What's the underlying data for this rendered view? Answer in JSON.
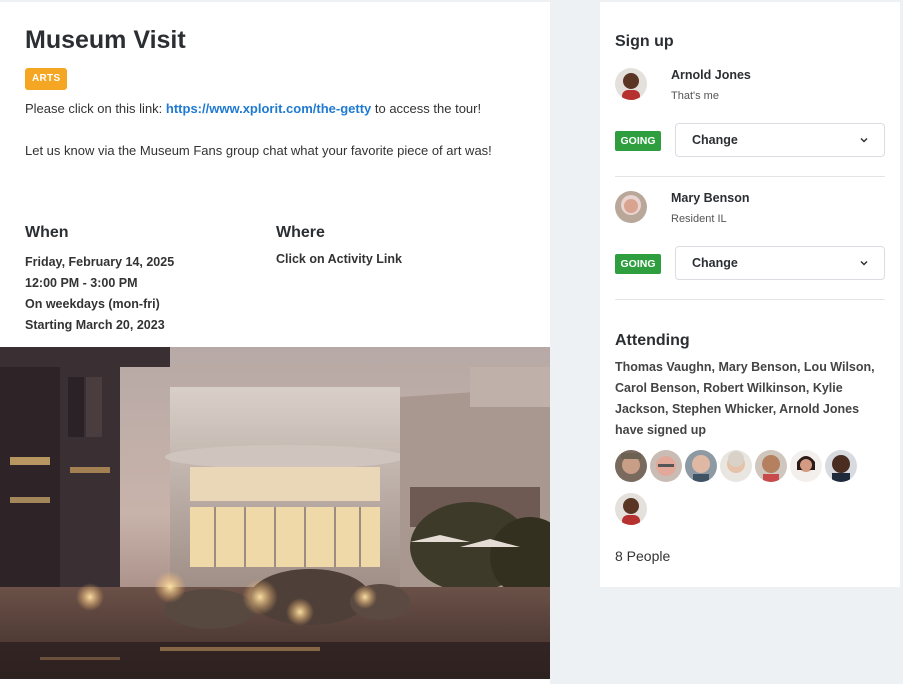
{
  "event": {
    "title": "Museum Visit",
    "category": "ARTS",
    "link_prefix": "Please click on this link: ",
    "link_text": "https://www.xplorit.com/the-getty",
    "link_suffix": " to access the tour!",
    "message": "Let us know via the Museum Fans group chat what your favorite piece of art was!",
    "when_heading": "When",
    "when_lines": [
      "Friday, February 14, 2025",
      "12:00 PM - 3:00 PM",
      "On weekdays (mon-fri)",
      "Starting March 20, 2023"
    ],
    "where_heading": "Where",
    "where_value": "Click on Activity Link"
  },
  "sidebar": {
    "signup_title": "Sign up",
    "signups": [
      {
        "name": "Arnold Jones",
        "sub": "That's me",
        "status": "GOING",
        "action": "Change"
      },
      {
        "name": "Mary Benson",
        "sub": "Resident IL",
        "status": "GOING",
        "action": "Change"
      }
    ],
    "attending_title": "Attending",
    "attending_text": "Thomas Vaughn, Mary Benson, Lou Wilson, Carol Benson, Robert Wilkinson, Kylie Jackson, Stephen Whicker, Arnold Jones have signed up",
    "people_count": "8 People"
  },
  "colors": {
    "badge": "#f5a623",
    "going": "#2e9e3f",
    "link": "#1f7ad1"
  }
}
